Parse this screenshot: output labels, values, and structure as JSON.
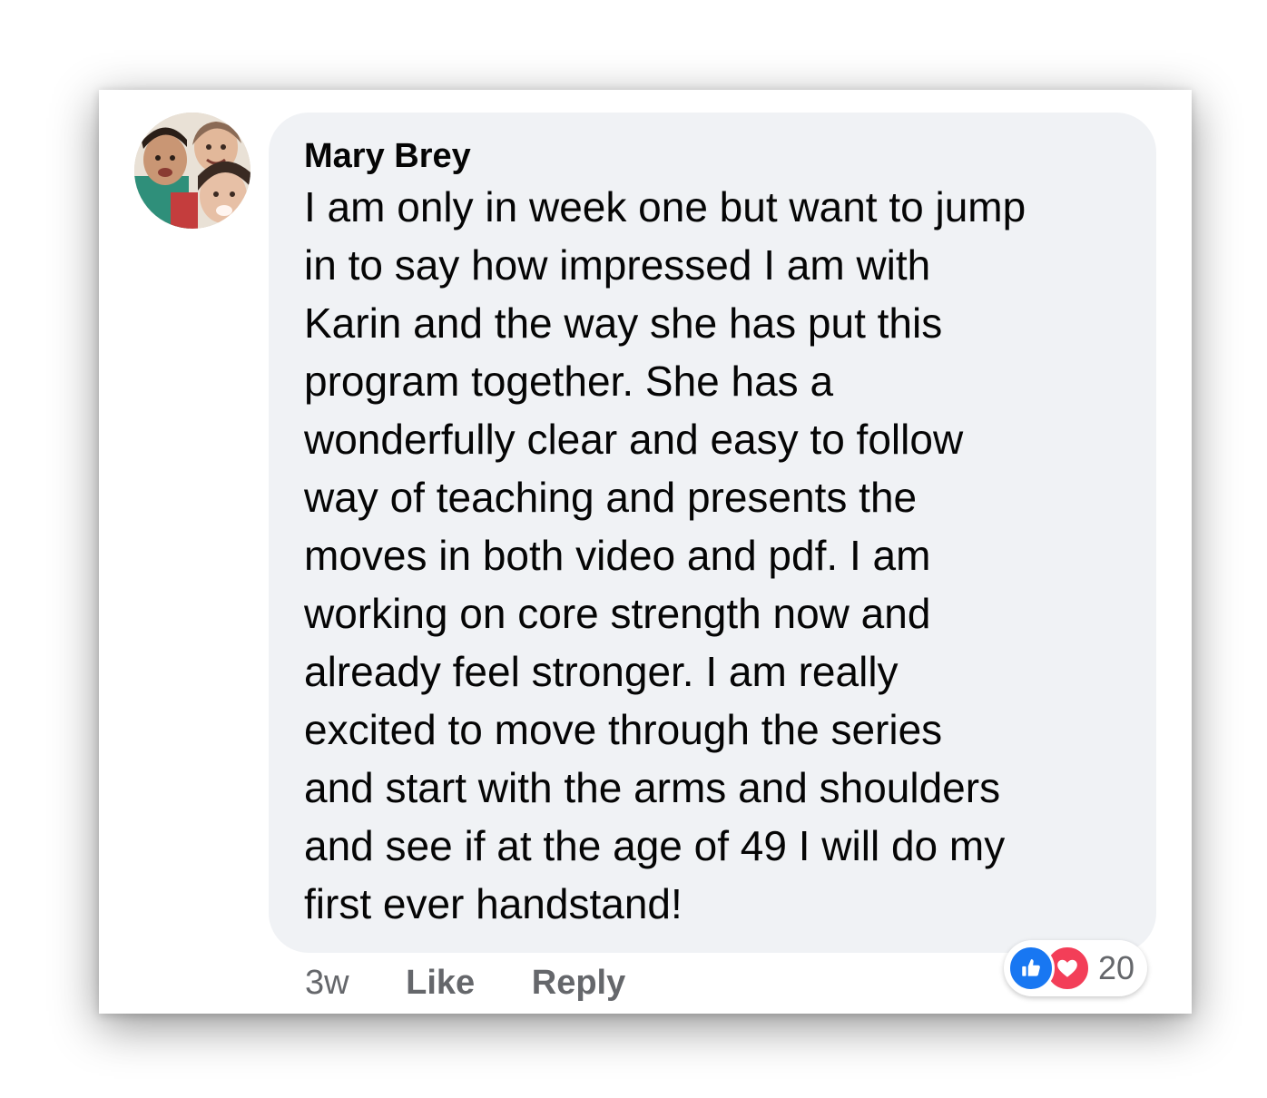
{
  "comment": {
    "author": "Mary Brey",
    "text_lines": [
      "I am only in week one but want to jump",
      "in to say how impressed I am with",
      "Karin and the way she has put this",
      "program together. She has a",
      "wonderfully clear and easy to follow",
      "way of teaching and presents the",
      "moves in both video and pdf. I am",
      "working on core strength now and",
      "already feel stronger. I am really",
      "excited to move through the series",
      "and start with the arms and shoulders",
      "and see if at the age of 49 I will do my",
      "first ever handstand!"
    ]
  },
  "actions": {
    "time": "3w",
    "like_label": "Like",
    "reply_label": "Reply"
  },
  "reactions": {
    "icons": [
      "thumbs-up-icon",
      "heart-icon"
    ],
    "count": "20"
  },
  "colors": {
    "bubble": "#f0f2f5",
    "like_blue": "#1877f2",
    "love_red": "#f33e58",
    "meta_text": "#65676b"
  }
}
